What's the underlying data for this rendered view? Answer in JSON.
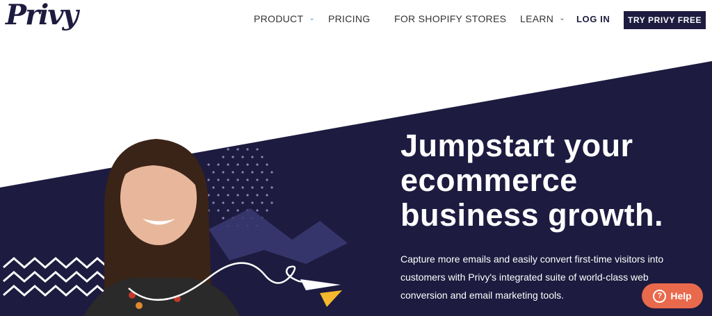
{
  "header": {
    "logo": "Privy",
    "nav": [
      {
        "label": "PRODUCT",
        "has_dropdown": true
      },
      {
        "label": "PRICING",
        "has_dropdown": false
      },
      {
        "label": "FOR SHOPIFY STORES",
        "has_dropdown": false
      },
      {
        "label": "LEARN",
        "has_dropdown": true
      }
    ],
    "login_label": "LOG IN",
    "cta_label": "TRY PRIVY FREE"
  },
  "hero": {
    "headline_lines": [
      "Jumpstart your",
      "ecommerce",
      "business growth."
    ],
    "subcopy_lines": [
      "Capture more emails and easily convert first-time visitors into",
      "customers with Privy's integrated suite of world-class web",
      "conversion and email marketing tools."
    ]
  },
  "help_widget": {
    "label": "Help",
    "icon": "question-circle-icon"
  },
  "colors": {
    "navy": "#1d1b3f",
    "help_orange": "#e9694c",
    "accent_yellow": "#f5b82e",
    "chevron_blue": "#3aa0c8"
  }
}
